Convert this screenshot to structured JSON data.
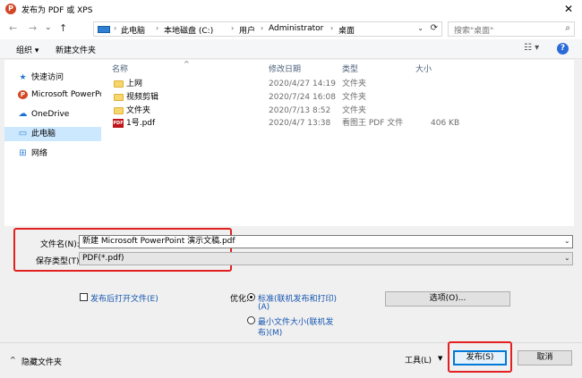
{
  "window": {
    "title": "发布为 PDF 或 XPS",
    "close": "✕",
    "app_logo": "P"
  },
  "nav": {
    "back": "←",
    "forward": "→",
    "history": "⌄",
    "up": "↑",
    "breadcrumb": [
      "此电脑",
      "本地磁盘 (C:)",
      "用户",
      "Administrator",
      "桌面"
    ],
    "refresh": "⟳",
    "dropdown": "⌄",
    "search_placeholder": "搜索\"桌面\"",
    "search_icon": "⌕"
  },
  "toolbar": {
    "organize": "组织 ▾",
    "new_folder": "新建文件夹",
    "view": "☷ ▾",
    "help": "?"
  },
  "sidebar": {
    "items": [
      {
        "label": "快速访问",
        "icon": "★",
        "icon_color": "#2b79d0"
      },
      {
        "label": "Microsoft PowerPo",
        "icon": "P",
        "icon_color": "#d24726"
      },
      {
        "label": "OneDrive",
        "icon": "☁",
        "icon_color": "#1e6fd9"
      },
      {
        "label": "此电脑",
        "icon": "▭",
        "icon_color": "#2f7fd3"
      },
      {
        "label": "网络",
        "icon": "⊞",
        "icon_color": "#2f7fd3"
      }
    ]
  },
  "files": {
    "columns": {
      "name": "名称",
      "modified": "修改日期",
      "type": "类型",
      "size": "大小"
    },
    "sort_arrow": "^",
    "rows": [
      {
        "name": "上网",
        "modified": "2020/4/27 14:19",
        "type": "文件夹",
        "size": "",
        "kind": "folder"
      },
      {
        "name": "视频剪辑",
        "modified": "2020/7/24 16:08",
        "type": "文件夹",
        "size": "",
        "kind": "folder"
      },
      {
        "name": "文件夹",
        "modified": "2020/7/13 8:52",
        "type": "文件夹",
        "size": "",
        "kind": "folder"
      },
      {
        "name": "1号.pdf",
        "modified": "2020/4/7 13:38",
        "type": "看图王 PDF 文件",
        "size": "406 KB",
        "kind": "pdf"
      }
    ]
  },
  "form": {
    "filename_label": "文件名(N):",
    "filename_value": "新建 Microsoft PowerPoint 演示文稿.pdf",
    "savetype_label": "保存类型(T):",
    "savetype_value": "PDF(*.pdf)",
    "open_after_label": "发布后打开文件(E)",
    "optimize_label": "优化:",
    "option_standard_line1": "标准(联机发布和打印)",
    "option_standard_line2": "(A)",
    "option_minimum_line1": "最小文件大小(联机发",
    "option_minimum_line2": "布)(M)",
    "options_button": "选项(O)...",
    "hide_folders": "隐藏文件夹",
    "tools_button": "工具(L)",
    "tools_arrow": "▼",
    "publish_button": "发布(S)",
    "cancel_button": "取消"
  },
  "colors": {
    "accent": "#0078d7",
    "highlight_box": "#e32020",
    "selected_nav": "#cce8ff"
  }
}
